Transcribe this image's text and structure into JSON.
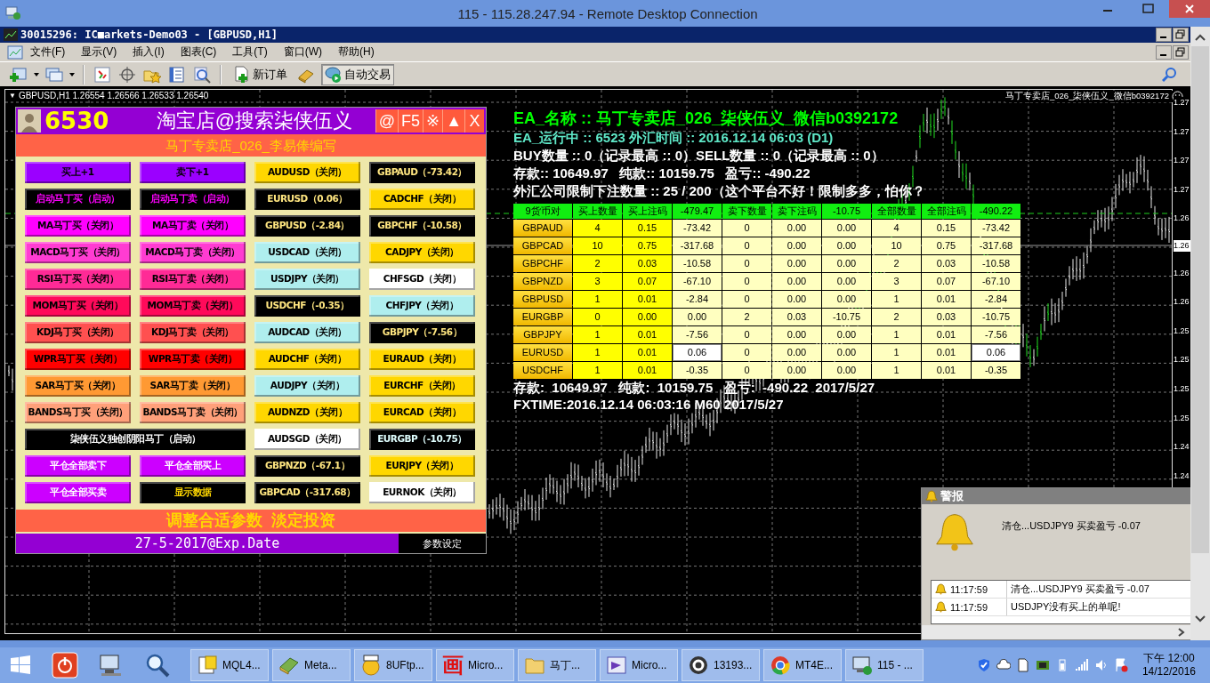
{
  "rdp_window": {
    "title": "115 - 115.28.247.94 - Remote Desktop Connection"
  },
  "mt4_window": {
    "title": "30015296: IC■arkets-Demo03 - [GBPUSD,H1]"
  },
  "menu": [
    "文件(F)",
    "显示(V)",
    "插入(I)",
    "图表(C)",
    "工具(T)",
    "窗口(W)",
    "帮助(H)"
  ],
  "toolbar_buttons": [
    {
      "label": "新订单",
      "on": false
    },
    {
      "label": "自动交易",
      "on": true
    }
  ],
  "chart": {
    "menu_glyph": "▼",
    "header": "GBPUSD,H1  1.26554 1.26566 1.26533 1.26540",
    "ea_label": "马丁专卖店_026_柒侠伍义_微信b0392172",
    "price_axis": [
      "1.27",
      "1.27",
      "1.27",
      "1.27",
      "1.26",
      "1.26",
      "1.26",
      "1.25",
      "1.25",
      "1.25",
      "1.25",
      "1.24",
      "1.24"
    ],
    "current_price": "1.26"
  },
  "panel": {
    "account": "6530",
    "title": "淘宝店@搜索柒侠伍义",
    "header_buttons": [
      "@",
      "F5",
      "※",
      "▲",
      "X"
    ],
    "subtitle": "马丁专卖店_026_李易俸编写",
    "buttons": [
      {
        "label": "买上+1",
        "kind": "cell",
        "color": "#9b00ff",
        "label_style": {
          "color": "#000000"
        }
      },
      {
        "label": "卖下+1",
        "kind": "cell",
        "color": "#9b00ff",
        "label_style": {
          "color": "#000000"
        }
      },
      {
        "label": "AUDUSD（关闭）",
        "kind": "cell",
        "color": "#ffd700",
        "label_style": {
          "color": "#000000"
        }
      },
      {
        "label": "GBPAUD（-73.42）",
        "kind": "cell",
        "color": "#000000",
        "label_style": {
          "color": "#ffe680"
        }
      },
      {
        "label": "启动马丁买（启动）",
        "kind": "cell",
        "color": "#000000",
        "label_style": {
          "color": "#ff00ff"
        }
      },
      {
        "label": "启动马丁卖（启动）",
        "kind": "cell",
        "color": "#000000",
        "label_style": {
          "color": "#ff00ff"
        }
      },
      {
        "label": "EURUSD（0.06）",
        "kind": "cell",
        "color": "#000000",
        "label_style": {
          "color": "#ffe680"
        }
      },
      {
        "label": "CADCHF（关闭）",
        "kind": "cell",
        "color": "#ffd700",
        "label_style": {
          "color": "#000000"
        }
      },
      {
        "label": "MA马丁买（关闭）",
        "kind": "cell",
        "color": "#ff00ff",
        "label_style": {
          "color": "#000000"
        }
      },
      {
        "label": "MA马丁卖（关闭）",
        "kind": "cell",
        "color": "#ff00ff",
        "label_style": {
          "color": "#000000"
        }
      },
      {
        "label": "GBPUSD（-2.84）",
        "kind": "cell",
        "color": "#000000",
        "label_style": {
          "color": "#ffe680"
        }
      },
      {
        "label": "GBPCHF（-10.58）",
        "kind": "cell",
        "color": "#000000",
        "label_style": {
          "color": "#ffe680"
        }
      },
      {
        "label": "MACD马丁买（关闭）",
        "kind": "cell",
        "color": "#ff3cd2",
        "label_style": {
          "color": "#000000"
        }
      },
      {
        "label": "MACD马丁卖（关闭）",
        "kind": "cell",
        "color": "#ff3cd2",
        "label_style": {
          "color": "#000000"
        }
      },
      {
        "label": "USDCAD（关闭）",
        "kind": "cell",
        "color": "#afeeee",
        "label_style": {
          "color": "#000000"
        }
      },
      {
        "label": "CADJPY（关闭）",
        "kind": "cell",
        "color": "#ffd700",
        "label_style": {
          "color": "#000000"
        }
      },
      {
        "label": "RSI马丁买（关闭）",
        "kind": "cell",
        "color": "#ff2a96",
        "label_style": {
          "color": "#000000"
        }
      },
      {
        "label": "RSI马丁卖（关闭）",
        "kind": "cell",
        "color": "#ff2a96",
        "label_style": {
          "color": "#000000"
        }
      },
      {
        "label": "USDJPY（关闭）",
        "kind": "cell",
        "color": "#afeeee",
        "label_style": {
          "color": "#000000"
        }
      },
      {
        "label": "CHFSGD（关闭）",
        "kind": "cell",
        "color": "#ffffff",
        "label_style": {
          "color": "#000000"
        }
      },
      {
        "label": "MOM马丁买（关闭）",
        "kind": "cell",
        "color": "#ff0a5a",
        "label_style": {
          "color": "#000000"
        }
      },
      {
        "label": "MOM马丁卖（关闭）",
        "kind": "cell",
        "color": "#ff0a5a",
        "label_style": {
          "color": "#000000"
        }
      },
      {
        "label": "USDCHF（-0.35）",
        "kind": "cell",
        "color": "#000000",
        "label_style": {
          "color": "#ffe680"
        }
      },
      {
        "label": "CHFJPY（关闭）",
        "kind": "cell",
        "color": "#afeeee",
        "label_style": {
          "color": "#000000"
        }
      },
      {
        "label": "KDJ马丁买（关闭）",
        "kind": "cell",
        "color": "#ff5050",
        "label_style": {
          "color": "#000000"
        }
      },
      {
        "label": "KDJ马丁卖（关闭）",
        "kind": "cell",
        "color": "#ff5050",
        "label_style": {
          "color": "#000000"
        }
      },
      {
        "label": "AUDCAD（关闭）",
        "kind": "cell",
        "color": "#afeeee",
        "label_style": {
          "color": "#000000"
        }
      },
      {
        "label": "GBPJPY（-7.56）",
        "kind": "cell",
        "color": "#000000",
        "label_style": {
          "color": "#ffe680"
        }
      },
      {
        "label": "WPR马丁买（关闭）",
        "kind": "cell",
        "color": "#ff0000",
        "label_style": {
          "color": "#000000"
        }
      },
      {
        "label": "WPR马丁卖（关闭）",
        "kind": "cell",
        "color": "#ff0000",
        "label_style": {
          "color": "#000000"
        }
      },
      {
        "label": "AUDCHF（关闭）",
        "kind": "cell",
        "color": "#ffd700",
        "label_style": {
          "color": "#000000"
        }
      },
      {
        "label": "EURAUD（关闭）",
        "kind": "cell",
        "color": "#ffd700",
        "label_style": {
          "color": "#000000"
        }
      },
      {
        "label": "SAR马丁买（关闭）",
        "kind": "cell",
        "color": "#ff9933",
        "label_style": {
          "color": "#000000"
        }
      },
      {
        "label": "SAR马丁卖（关闭）",
        "kind": "cell",
        "color": "#ff9933",
        "label_style": {
          "color": "#000000"
        }
      },
      {
        "label": "AUDJPY（关闭）",
        "kind": "cell",
        "color": "#afeeee",
        "label_style": {
          "color": "#000000"
        }
      },
      {
        "label": "EURCHF（关闭）",
        "kind": "cell",
        "color": "#ffd700",
        "label_style": {
          "color": "#000000"
        }
      },
      {
        "label": "BANDS马丁买（关闭）",
        "kind": "cell",
        "color": "#ffa07a",
        "label_style": {
          "color": "#000000"
        }
      },
      {
        "label": "BANDS马丁卖（关闭）",
        "kind": "cell",
        "color": "#ffa07a",
        "label_style": {
          "color": "#000000"
        }
      },
      {
        "label": "AUDNZD（关闭）",
        "kind": "cell",
        "color": "#ffd700",
        "label_style": {
          "color": "#000000"
        }
      },
      {
        "label": "EURCAD（关闭）",
        "kind": "cell",
        "color": "#ffd700",
        "label_style": {
          "color": "#000000"
        }
      },
      {
        "label": "柒侠伍义独创阴阳马丁（启动）",
        "kind": "wide",
        "color": "#000000",
        "label_style": {
          "color": "#ffffff"
        }
      },
      {
        "label": "AUDSGD（关闭）",
        "kind": "cell",
        "color": "#ffffff",
        "label_style": {
          "color": "#000000"
        }
      },
      {
        "label": "EURGBP（-10.75）",
        "kind": "cell",
        "color": "#000000",
        "label_style": {
          "color": "#e0ffff"
        }
      },
      {
        "label": "平仓全部卖下",
        "kind": "cell",
        "color": "#cc00ff",
        "label_style": {
          "color": "#ffffff"
        }
      },
      {
        "label": "平仓全部买上",
        "kind": "cell",
        "color": "#cc00ff",
        "label_style": {
          "color": "#ffffff"
        }
      },
      {
        "label": "GBPNZD（-67.1）",
        "kind": "cell",
        "color": "#000000",
        "label_style": {
          "color": "#ffe680"
        }
      },
      {
        "label": "EURJPY（关闭）",
        "kind": "cell",
        "color": "#ffd700",
        "label_style": {
          "color": "#000000"
        }
      },
      {
        "label": "平仓全部买卖",
        "kind": "cell",
        "color": "#cc00ff",
        "label_style": {
          "color": "#ffffff"
        }
      },
      {
        "label": "显示数据",
        "kind": "cell",
        "color": "#000000",
        "label_style": {
          "color": "#ffd700"
        }
      },
      {
        "label": "GBPCAD（-317.68）",
        "kind": "cell",
        "color": "#000000",
        "label_style": {
          "color": "#ffe680"
        }
      },
      {
        "label": "EURNOK（关闭）",
        "kind": "cell",
        "color": "#ffffff",
        "label_style": {
          "color": "#000000"
        }
      }
    ],
    "slogan": "调整合适参数  淡定投资",
    "expiry": "27-5-2017@Exp.Date",
    "settings_button": "参数设定"
  },
  "info_lines": [
    {
      "text": "EA_名称 :: 马丁专卖店_026_柒侠伍义_微信b0392172",
      "color": "#00ff00"
    },
    {
      "text": "EA_运行中 :: 6523 外汇时间 :: 2016.12.14 06:03 (D1)",
      "color": "#5fe8c8"
    },
    {
      "text": "BUY数量 :: 0（记录最高 :: 0）SELL数量 :: 0（记录最高 :: 0）",
      "color": "#ffffff"
    },
    {
      "text": "存款:: 10649.97   纯款:: 10159.75   盈亏:: -490.22",
      "color": "#ffffff"
    },
    {
      "text": "外汇公司限制下注数量 :: 25 / 200（这个平台不好！限制多多，怕你？",
      "color": "#ffffff"
    }
  ],
  "table": {
    "columns": [
      "9货币对",
      "买上数量",
      "买上注码",
      "-479.47",
      "卖下数量",
      "卖下注码",
      "-10.75",
      "全部数量",
      "全部注码",
      "-490.22"
    ],
    "rows": [
      {
        "cells": [
          "GBPAUD",
          "4",
          "0.15",
          "-73.42",
          "0",
          "0.00",
          "0.00",
          "4",
          "0.15",
          "-73.42"
        ],
        "in_profit": false
      },
      {
        "cells": [
          "GBPCAD",
          "10",
          "0.75",
          "-317.68",
          "0",
          "0.00",
          "0.00",
          "10",
          "0.75",
          "-317.68"
        ],
        "in_profit": false
      },
      {
        "cells": [
          "GBPCHF",
          "2",
          "0.03",
          "-10.58",
          "0",
          "0.00",
          "0.00",
          "2",
          "0.03",
          "-10.58"
        ],
        "in_profit": false
      },
      {
        "cells": [
          "GBPNZD",
          "3",
          "0.07",
          "-67.10",
          "0",
          "0.00",
          "0.00",
          "3",
          "0.07",
          "-67.10"
        ],
        "in_profit": false
      },
      {
        "cells": [
          "GBPUSD",
          "1",
          "0.01",
          "-2.84",
          "0",
          "0.00",
          "0.00",
          "1",
          "0.01",
          "-2.84"
        ],
        "in_profit": false
      },
      {
        "cells": [
          "EURGBP",
          "0",
          "0.00",
          "0.00",
          "2",
          "0.03",
          "-10.75",
          "2",
          "0.03",
          "-10.75"
        ],
        "in_profit": false
      },
      {
        "cells": [
          "GBPJPY",
          "1",
          "0.01",
          "-7.56",
          "0",
          "0.00",
          "0.00",
          "1",
          "0.01",
          "-7.56"
        ],
        "in_profit": false
      },
      {
        "cells": [
          "EURUSD",
          "1",
          "0.01",
          "0.06",
          "0",
          "0.00",
          "0.00",
          "1",
          "0.01",
          "0.06"
        ],
        "in_profit": true
      },
      {
        "cells": [
          "USDCHF",
          "1",
          "0.01",
          "-0.35",
          "0",
          "0.00",
          "0.00",
          "1",
          "0.01",
          "-0.35"
        ],
        "in_profit": false
      }
    ]
  },
  "footer_lines": [
    "存款:  10649.97   纯款:  10159.75   盈亏:  -490.22  2017/5/27",
    "FXTIME:2016.12.14 06:03:16 M60 2017/5/27"
  ],
  "alert": {
    "title": "警报",
    "message": "清仓...USDJPY9 买卖盈亏 -0.07",
    "rows": [
      {
        "time": "11:17:59",
        "text": "清仓...USDJPY9 买卖盈亏 -0.07"
      },
      {
        "time": "11:17:59",
        "text": "USDJPY没有买上的单呢!"
      }
    ]
  },
  "taskbar": {
    "tasks": [
      {
        "kind": "help",
        "label": "MQL4..."
      },
      {
        "kind": "book",
        "label": "Meta..."
      },
      {
        "kind": "ftp",
        "label": "8UFtp..."
      },
      {
        "kind": "glyph",
        "glyph": "画",
        "label": "Micro..."
      },
      {
        "kind": "folder",
        "label": "马丁..."
      },
      {
        "kind": "studio",
        "label": "Micro..."
      },
      {
        "kind": "ring",
        "label": "13193..."
      },
      {
        "kind": "browser",
        "label": "MT4E..."
      },
      {
        "kind": "remote",
        "label": "115 - ..."
      }
    ],
    "clock_time": "下午 12:00",
    "clock_date": "14/12/2016"
  }
}
